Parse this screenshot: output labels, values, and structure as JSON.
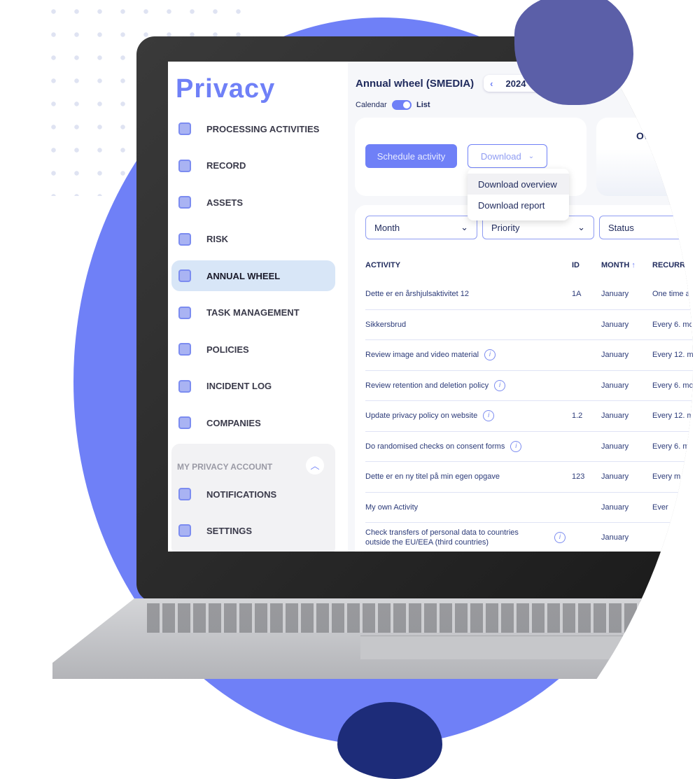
{
  "sidebar": {
    "logo": "Privacy",
    "items": [
      {
        "label": "PROCESSING ACTIVITIES",
        "icon": "processing-icon"
      },
      {
        "label": "RECORD",
        "icon": "record-icon"
      },
      {
        "label": "ASSETS",
        "icon": "assets-icon"
      },
      {
        "label": "RISK",
        "icon": "gauge-icon"
      },
      {
        "label": "ANNUAL WHEEL",
        "icon": "annual-wheel-icon",
        "active": true
      },
      {
        "label": "TASK MANAGEMENT",
        "icon": "calendar-edit-icon"
      },
      {
        "label": "POLICIES",
        "icon": "policy-icon"
      },
      {
        "label": "INCIDENT LOG",
        "icon": "lock-icon"
      },
      {
        "label": "COMPANIES",
        "icon": "buildings-icon"
      }
    ],
    "account": {
      "title": "MY PRIVACY ACCOUNT",
      "items": [
        {
          "label": "NOTIFICATIONS",
          "icon": "bell-icon"
        },
        {
          "label": "SETTINGS",
          "icon": "gear-icon"
        }
      ]
    }
  },
  "header": {
    "title": "Annual wheel (SMEDIA)",
    "year": "2024",
    "prev": "‹",
    "next": "›",
    "view_left": "Calendar",
    "view_right": "List"
  },
  "actions": {
    "schedule": "Schedule activity",
    "download": "Download",
    "menu": [
      "Download overview",
      "Download report"
    ],
    "overview_card": "Ov"
  },
  "filters": [
    "Month",
    "Priority",
    "Status"
  ],
  "table": {
    "columns": [
      "ACTIVITY",
      "ID",
      "MONTH",
      "RECURREN"
    ],
    "sort": "↑",
    "rows": [
      {
        "activity": "Dette er en årshjulsaktivitet 12",
        "info": false,
        "id": "1A",
        "month": "January",
        "recurrence": "One time a"
      },
      {
        "activity": "Sikkersbrud",
        "info": false,
        "id": "",
        "month": "January",
        "recurrence": "Every 6. mo"
      },
      {
        "activity": "Review image and video material",
        "info": true,
        "id": "",
        "month": "January",
        "recurrence": "Every 12. m"
      },
      {
        "activity": "Review retention and deletion policy",
        "info": true,
        "id": "",
        "month": "January",
        "recurrence": "Every 6. mo"
      },
      {
        "activity": "Update privacy policy on website",
        "info": true,
        "id": "1.2",
        "month": "January",
        "recurrence": "Every 12. m"
      },
      {
        "activity": "Do randomised checks on consent forms",
        "info": true,
        "id": "",
        "month": "January",
        "recurrence": "Every 6. m"
      },
      {
        "activity": "Dette er en ny titel på min egen opgave",
        "info": false,
        "id": "123",
        "month": "January",
        "recurrence": "Every m"
      },
      {
        "activity": "My own Activity",
        "info": false,
        "id": "",
        "month": "January",
        "recurrence": "Ever"
      },
      {
        "activity": "Check transfers of personal data to countries outside the EU/EEA (third countries)",
        "info": true,
        "id": "",
        "month": "January",
        "recurrence": ""
      }
    ]
  },
  "colors": {
    "accent": "#6f80f7",
    "navy": "#1f2a5c",
    "blob": "#6f80f7",
    "blob_dark": "#5b5fa8",
    "blob_navy": "#1d2c79"
  }
}
